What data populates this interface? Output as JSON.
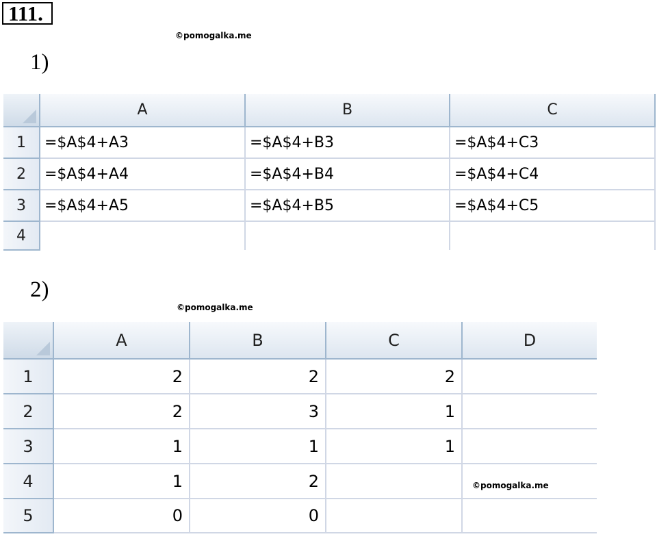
{
  "problem_number": "111.",
  "watermarks": [
    "©pomogalka.me",
    "©pomogalka.me",
    "©pomogalka.me"
  ],
  "part1": {
    "label": "1)",
    "columns": [
      "A",
      "B",
      "C"
    ],
    "rows": [
      {
        "num": "1",
        "cells": [
          "=$A$4+A3",
          "=$A$4+B3",
          "=$A$4+C3"
        ]
      },
      {
        "num": "2",
        "cells": [
          "=$A$4+A4",
          "=$A$4+B4",
          "=$A$4+C4"
        ]
      },
      {
        "num": "3",
        "cells": [
          "=$A$4+A5",
          "=$A$4+B5",
          "=$A$4+C5"
        ]
      },
      {
        "num": "4",
        "cells": [
          "",
          "",
          ""
        ]
      }
    ]
  },
  "part2": {
    "label": "2)",
    "columns": [
      "A",
      "B",
      "C",
      "D"
    ],
    "rows": [
      {
        "num": "1",
        "cells": [
          "2",
          "2",
          "2",
          ""
        ]
      },
      {
        "num": "2",
        "cells": [
          "2",
          "3",
          "1",
          ""
        ]
      },
      {
        "num": "3",
        "cells": [
          "1",
          "1",
          "1",
          ""
        ]
      },
      {
        "num": "4",
        "cells": [
          "1",
          "2",
          "",
          ""
        ]
      },
      {
        "num": "5",
        "cells": [
          "0",
          "0",
          "",
          ""
        ]
      }
    ]
  }
}
